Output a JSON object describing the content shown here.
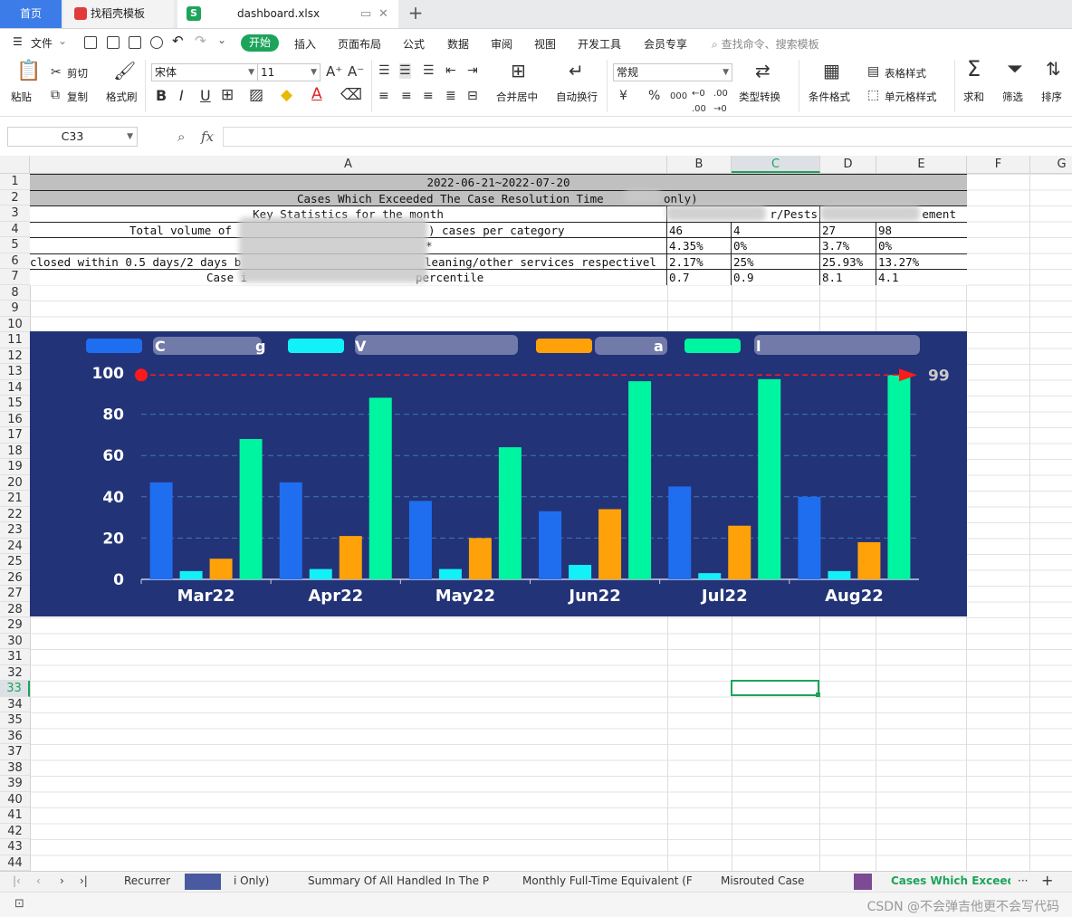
{
  "tabs": {
    "home": "首页",
    "template": "找稻壳模板",
    "file": "dashboard.xlsx",
    "file_icon": "S"
  },
  "menu": {
    "file": "文件",
    "start": "开始",
    "items": [
      "插入",
      "页面布局",
      "公式",
      "数据",
      "审阅",
      "视图",
      "开发工具",
      "会员专享"
    ],
    "search": "查找命令、搜索模板"
  },
  "ribbon": {
    "paste": "粘贴",
    "cut": "剪切",
    "copy": "复制",
    "format_painter": "格式刷",
    "font_name": "宋体",
    "font_size": "11",
    "merge_center": "合并居中",
    "wrap_text": "自动换行",
    "number_format": "常规",
    "currency_symbol": "¥",
    "percent_symbol": "%",
    "thousands": "000",
    "convert": "类型转换",
    "cond_format": "条件格式",
    "table_style": "表格样式",
    "cell_style": "单元格样式",
    "sum": "求和",
    "filter": "筛选",
    "sort": "排序",
    "bold": "B",
    "italic": "I",
    "underline": "U"
  },
  "formula_bar": {
    "name_box": "C33",
    "fx": "fx",
    "formula": ""
  },
  "columns": [
    "A",
    "B",
    "C",
    "D",
    "E",
    "F",
    "G"
  ],
  "rows": [
    "1",
    "2",
    "3",
    "4",
    "5",
    "6",
    "7",
    "8",
    "9",
    "10",
    "11",
    "12",
    "13",
    "14",
    "15",
    "16",
    "17",
    "18",
    "19",
    "20",
    "21",
    "22",
    "23",
    "24",
    "25",
    "26",
    "27",
    "28",
    "29",
    "30",
    "31",
    "32",
    "33",
    "34",
    "35",
    "36",
    "37",
    "38",
    "39",
    "40",
    "41",
    "42",
    "43",
    "44"
  ],
  "sheet_table": {
    "r1": "2022-06-21~2022-07-20",
    "r2a": "Cases Which Exceeded The Case Resolution Time",
    "r2b": "only)",
    "r3a": "Key Statistics for the month",
    "r3c": "r/Pests",
    "r3e": "ement",
    "r4a1": "Total volume of",
    "r4a2": ") cases per category",
    "r4": [
      "46",
      "4",
      "27",
      "98"
    ],
    "r5a": "*",
    "r5": [
      "4.35%",
      "0%",
      "3.7%",
      "0%"
    ],
    "r6a1": "closed within 0.5 days/2 days b",
    "r6a2": "leaning/other services respectivel",
    "r6": [
      "2.17%",
      "25%",
      "25.93%",
      "13.27%"
    ],
    "r7a1": "Case i",
    "r7a2": "percentile",
    "r7": [
      "0.7",
      "0.9",
      "8.1",
      "4.1"
    ]
  },
  "chart_data": {
    "type": "bar",
    "categories": [
      "Mar22",
      "Apr22",
      "May22",
      "Jun22",
      "Jul22",
      "Aug22"
    ],
    "ylim": [
      0,
      100
    ],
    "yticks": [
      "0",
      "20",
      "40",
      "60",
      "80",
      "100"
    ],
    "grid": true,
    "legend": "top",
    "series": [
      {
        "color": "#1f6ef0",
        "values": [
          47,
          47,
          38,
          33,
          45,
          40
        ]
      },
      {
        "color": "#12f0f8",
        "values": [
          4,
          5,
          5,
          7,
          3,
          4
        ]
      },
      {
        "color": "#ffa20a",
        "values": [
          10,
          21,
          20,
          34,
          26,
          18
        ]
      },
      {
        "color": "#00f5a0",
        "values": [
          68,
          88,
          64,
          96,
          97,
          99
        ]
      }
    ],
    "markline": {
      "value": 99,
      "label": "99",
      "color": "#ff1a1a"
    },
    "legend_text": [
      "C",
      "g",
      "V",
      "a",
      "l"
    ]
  },
  "sheets": {
    "s1": "Recurrer",
    "s2": "i Only)",
    "s3": "Summary Of All Handled In The P",
    "s4": "Monthly Full-Time Equivalent (F",
    "s5": "Misrouted Case",
    "s6": "Cases Which Exceeded",
    "more": "···",
    "add": "+"
  },
  "watermark": "CSDN @不会弹吉他更不会写代码"
}
